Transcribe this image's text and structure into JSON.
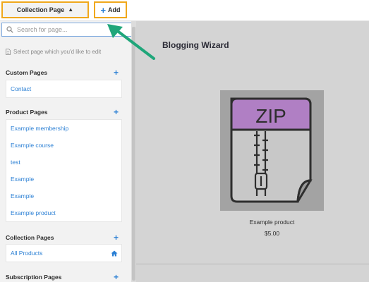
{
  "topbar": {
    "collection_label": "Collection Page",
    "add_label": "Add"
  },
  "sidebar": {
    "search_placeholder": "Search for page...",
    "hint": "Select page which you'd like to edit",
    "sections": [
      {
        "title": "Custom Pages",
        "items": [
          "Contact"
        ]
      },
      {
        "title": "Product Pages",
        "items": [
          "Example membership",
          "Example course",
          "test",
          "Example",
          "Example",
          "Example product"
        ]
      },
      {
        "title": "Collection Pages",
        "items": [
          "All Products"
        ]
      },
      {
        "title": "Subscription Pages",
        "items": []
      }
    ]
  },
  "main": {
    "store_title": "Blogging Wizard",
    "product": {
      "icon_text": "ZIP",
      "name": "Example product",
      "price": "$5.00"
    }
  },
  "colors": {
    "highlight_border": "#f0a81c",
    "accent_blue": "#2a7fd4",
    "annotation_arrow": "#1fa67a",
    "zip_label": "#b07fc4"
  }
}
